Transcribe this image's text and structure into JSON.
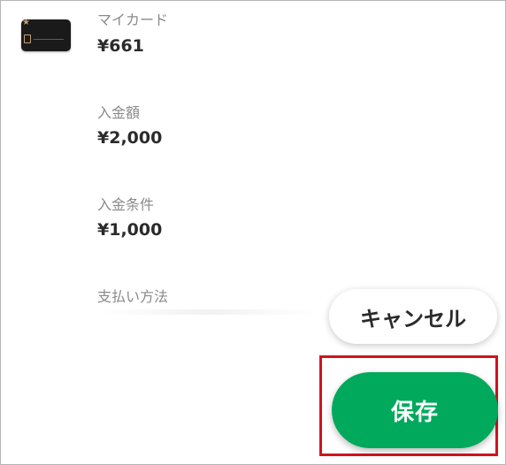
{
  "colors": {
    "accent_green": "#00a95c",
    "highlight_red": "#d0131d",
    "label_gray": "#8a8a8a",
    "value_dark": "#2b2b2b"
  },
  "card": {
    "thumbnail_icon": "card-thumbnail",
    "label": "マイカード",
    "balance": "¥661"
  },
  "fields": [
    {
      "label": "入金額",
      "value": "¥2,000"
    },
    {
      "label": "入金条件",
      "value": "¥1,000"
    },
    {
      "label": "支払い方法"
    }
  ],
  "buttons": {
    "cancel_label": "キャンセル",
    "save_label": "保存"
  }
}
